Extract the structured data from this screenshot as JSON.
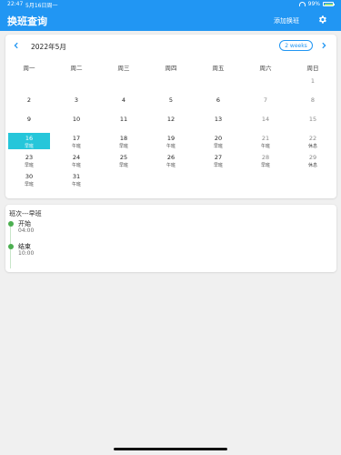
{
  "status_bar": {
    "time": "22:47",
    "date": "5月16日周一",
    "battery": "99%"
  },
  "app_bar": {
    "title": "换班查询",
    "action_label": "添加换班",
    "settings_icon": "gear-icon"
  },
  "calendar": {
    "month_title": "2022年5月",
    "format_button": "2 weeks",
    "weekdays": [
      "周一",
      "周二",
      "周三",
      "周四",
      "周五",
      "周六",
      "周日"
    ],
    "weeks": [
      [
        {
          "day": "",
          "shift": ""
        },
        {
          "day": "",
          "shift": ""
        },
        {
          "day": "",
          "shift": ""
        },
        {
          "day": "",
          "shift": ""
        },
        {
          "day": "",
          "shift": ""
        },
        {
          "day": "",
          "shift": ""
        },
        {
          "day": "1",
          "shift": ""
        }
      ],
      [
        {
          "day": "2",
          "shift": ""
        },
        {
          "day": "3",
          "shift": ""
        },
        {
          "day": "4",
          "shift": ""
        },
        {
          "day": "5",
          "shift": ""
        },
        {
          "day": "6",
          "shift": ""
        },
        {
          "day": "7",
          "shift": ""
        },
        {
          "day": "8",
          "shift": ""
        }
      ],
      [
        {
          "day": "9",
          "shift": ""
        },
        {
          "day": "10",
          "shift": ""
        },
        {
          "day": "11",
          "shift": ""
        },
        {
          "day": "12",
          "shift": ""
        },
        {
          "day": "13",
          "shift": ""
        },
        {
          "day": "14",
          "shift": ""
        },
        {
          "day": "15",
          "shift": ""
        }
      ],
      [
        {
          "day": "16",
          "shift": "早班",
          "selected": true
        },
        {
          "day": "17",
          "shift": "午班"
        },
        {
          "day": "18",
          "shift": "早班"
        },
        {
          "day": "19",
          "shift": "午班"
        },
        {
          "day": "20",
          "shift": "早班"
        },
        {
          "day": "21",
          "shift": "午班"
        },
        {
          "day": "22",
          "shift": "休息"
        }
      ],
      [
        {
          "day": "23",
          "shift": "早班"
        },
        {
          "day": "24",
          "shift": "午班"
        },
        {
          "day": "25",
          "shift": "早班"
        },
        {
          "day": "26",
          "shift": "午班"
        },
        {
          "day": "27",
          "shift": "早班"
        },
        {
          "day": "28",
          "shift": "早班"
        },
        {
          "day": "29",
          "shift": "休息"
        }
      ],
      [
        {
          "day": "30",
          "shift": "早班"
        },
        {
          "day": "31",
          "shift": "午班"
        },
        {
          "day": "",
          "shift": ""
        },
        {
          "day": "",
          "shift": ""
        },
        {
          "day": "",
          "shift": ""
        },
        {
          "day": "",
          "shift": ""
        },
        {
          "day": "",
          "shift": ""
        }
      ]
    ]
  },
  "shift_detail": {
    "title": "班次---早班",
    "entries": [
      {
        "label": "开始",
        "time": "04:00"
      },
      {
        "label": "结束",
        "time": "10:00"
      }
    ]
  },
  "colors": {
    "primary": "#2196f3",
    "selected": "#26c6da",
    "timeline": "#4caf50"
  }
}
